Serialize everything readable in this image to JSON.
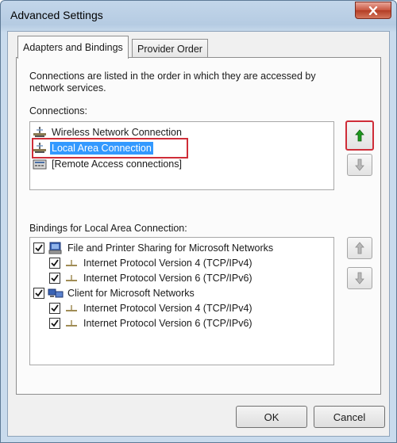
{
  "window": {
    "title": "Advanced Settings"
  },
  "tabs": [
    {
      "label": "Adapters and Bindings"
    },
    {
      "label": "Provider Order"
    }
  ],
  "adapters": {
    "description": "Connections are listed in the order in which they are accessed by network services.",
    "connections_label": "Connections:",
    "connections": [
      {
        "label": "Wireless Network Connection",
        "icon": "network-adapter-icon"
      },
      {
        "label": "Local Area Connection",
        "icon": "network-adapter-icon",
        "selected": true
      },
      {
        "label": "[Remote Access connections]",
        "icon": "remote-access-icon"
      }
    ],
    "bindings_label": "Bindings for Local Area Connection:",
    "bindings": [
      {
        "label": "File and Printer Sharing for Microsoft Networks",
        "checked": true,
        "icon": "file-printer-sharing-icon",
        "children": [
          {
            "label": "Internet Protocol Version 4 (TCP/IPv4)",
            "checked": true,
            "icon": "protocol-icon"
          },
          {
            "label": "Internet Protocol Version 6 (TCP/IPv6)",
            "checked": true,
            "icon": "protocol-icon"
          }
        ]
      },
      {
        "label": "Client for Microsoft Networks",
        "checked": true,
        "icon": "client-icon",
        "children": [
          {
            "label": "Internet Protocol Version 4 (TCP/IPv4)",
            "checked": true,
            "icon": "protocol-icon"
          },
          {
            "label": "Internet Protocol Version 6 (TCP/IPv6)",
            "checked": true,
            "icon": "protocol-icon"
          }
        ]
      }
    ]
  },
  "buttons": {
    "ok": "OK",
    "cancel": "Cancel"
  },
  "colors": {
    "selection": "#3399ff",
    "highlight_box": "#cf2d38",
    "up_arrow_active": "#1f9a1f"
  }
}
